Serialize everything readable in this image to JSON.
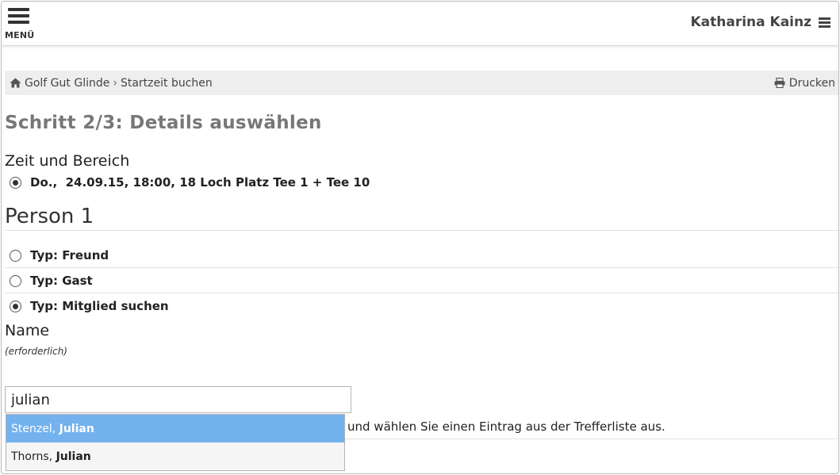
{
  "header": {
    "menu_label": "MENÜ",
    "user_name": "Katharina Kainz"
  },
  "breadcrumb": {
    "items": [
      "Golf Gut Glinde",
      "Startzeit buchen"
    ],
    "print_label": "Drucken"
  },
  "step_title": "Schritt 2/3: Details auswählen",
  "time_section": {
    "heading": "Zeit und Bereich",
    "option": "Do.,  24.09.15, 18:00, 18 Loch Platz Tee 1 + Tee 10",
    "option_checked": true
  },
  "person": {
    "heading": "Person 1",
    "types": [
      {
        "label": "Typ: Freund",
        "checked": false
      },
      {
        "label": "Typ: Gast",
        "checked": false
      },
      {
        "label": "Typ: Mitglied suchen",
        "checked": true
      }
    ]
  },
  "name_field": {
    "label": "Name",
    "required_note": "(erforderlich)",
    "value": "julian",
    "hint": "und wählen Sie einen Eintrag aus der Trefferliste aus."
  },
  "suggestions": [
    {
      "surname": "Stenzel, ",
      "firstname": "Julian",
      "active": true
    },
    {
      "surname": "Thorns, ",
      "firstname": "Julian",
      "active": false
    }
  ],
  "colors": {
    "accent_highlight": "#73b2ee",
    "breadcrumb_bg": "#eeeeee",
    "title_gray": "#777777"
  }
}
